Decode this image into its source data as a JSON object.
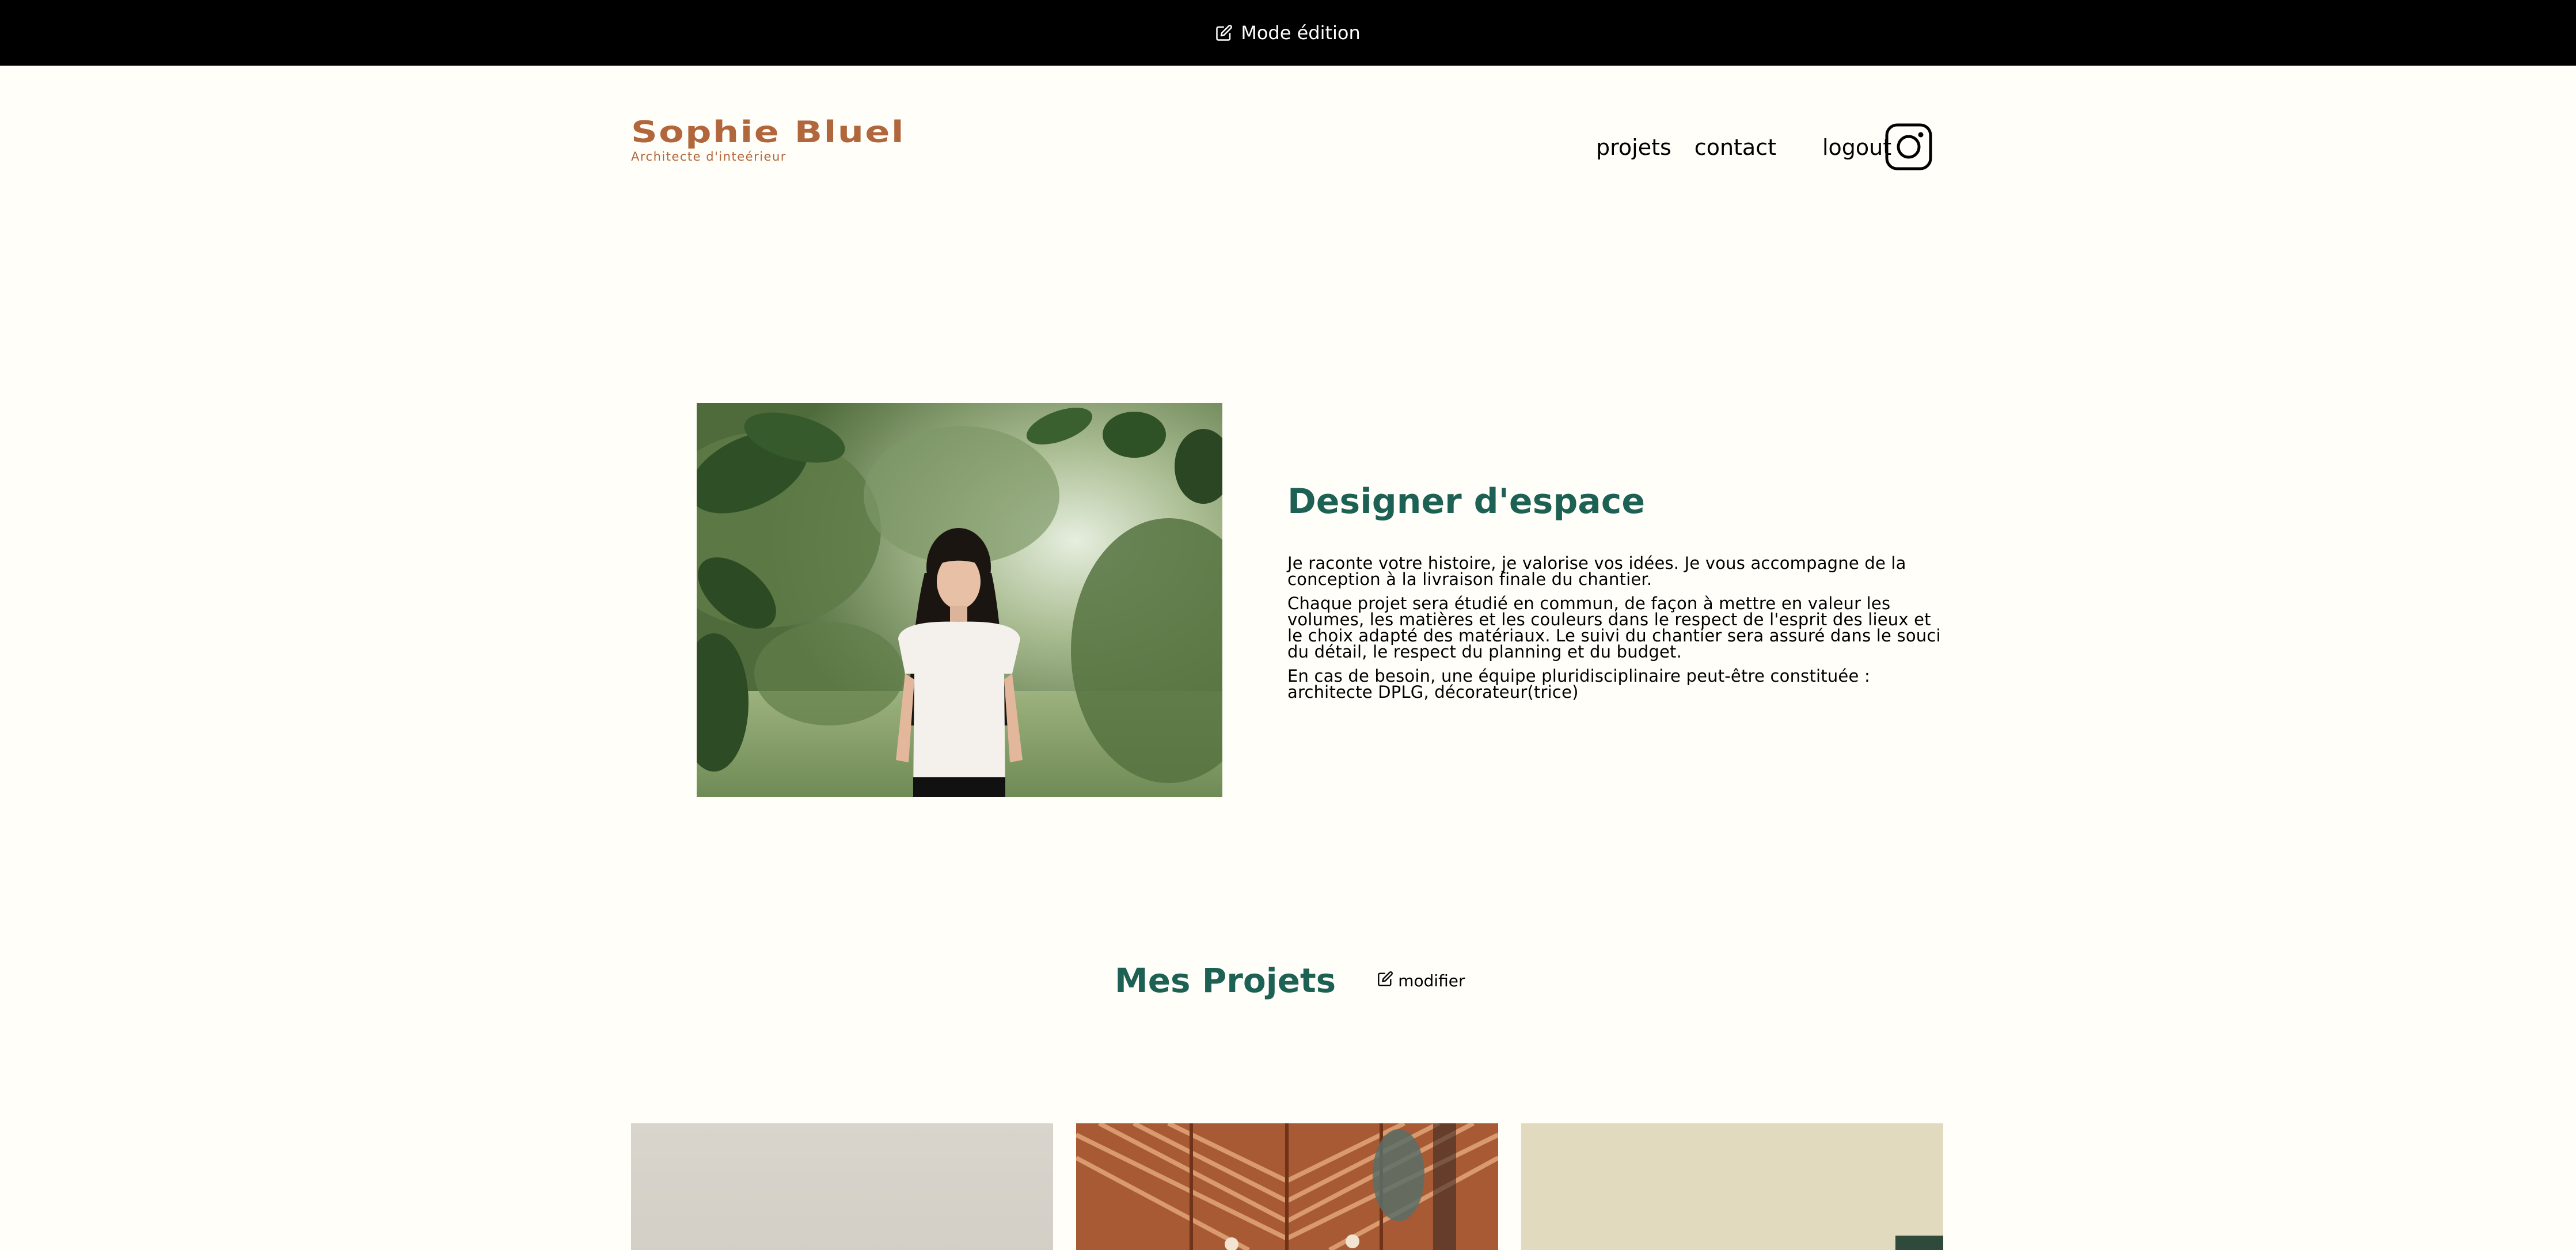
{
  "topbar": {
    "edit_mode_label": "Mode édition",
    "icon": "edit-icon"
  },
  "header": {
    "logo_name": "Sophie Bluel",
    "logo_subtitle": "Architecte d'inteérieur",
    "nav": {
      "projets": "projets",
      "contact": "contact",
      "logout": "logout"
    },
    "social_icon": "instagram-icon"
  },
  "about": {
    "image_alt": "Sophie Bluel",
    "title": "Designer d'espace",
    "paragraphs": [
      "Je raconte votre histoire, je valorise vos idées. Je vous accompagne de la conception à la livraison finale du chantier.",
      "Chaque projet sera étudié en commun, de façon à mettre en valeur les volumes, les matières et les couleurs dans le respect de l'esprit des lieux et le choix adapté des matériaux. Le suivi du chantier sera assuré dans le souci du détail, le respect du planning et du budget.",
      "En cas de besoin, une équipe pluridisciplinaire peut-être constituée : architecte DPLG, décorateur(trice)"
    ]
  },
  "projects": {
    "title": "Mes Projets",
    "modify_label": "modifier"
  },
  "colors": {
    "brand_orange": "#B1663C",
    "brand_green": "#1D6154",
    "background": "#FFFEF8",
    "topbar": "#000000"
  }
}
